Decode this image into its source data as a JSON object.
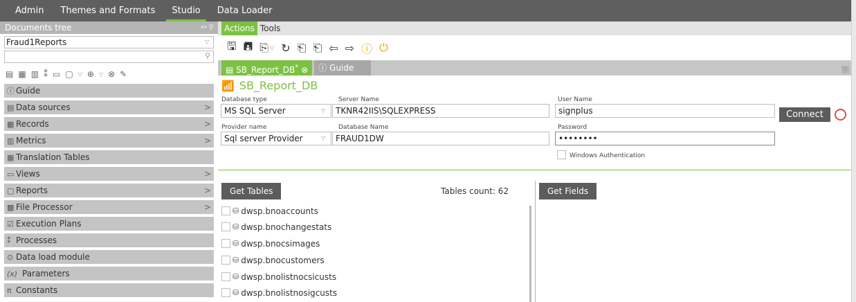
{
  "topmenu": {
    "items": [
      "Admin",
      "Themes and Formats",
      "Studio",
      "Data Loader"
    ],
    "active": "Studio"
  },
  "left": {
    "doc_tree_title": "Documents tree",
    "doc_tree_ctrls": "↔ ⚲",
    "report_select": "Fraud1Reports",
    "search_placeholder": "",
    "nav": [
      {
        "label": "Guide",
        "icon": "ⓘ",
        "chevron": ""
      },
      {
        "label": "Data sources",
        "icon": "▤",
        "chevron": ">"
      },
      {
        "label": "Records",
        "icon": "▦",
        "chevron": ">"
      },
      {
        "label": "Metrics",
        "icon": "▥",
        "chevron": ">"
      },
      {
        "label": "Translation Tables",
        "icon": "▦",
        "chevron": ""
      },
      {
        "label": "Views",
        "icon": "▭",
        "chevron": ">"
      },
      {
        "label": "Reports",
        "icon": "▢",
        "chevron": ">"
      },
      {
        "label": "File Processor",
        "icon": "▩",
        "chevron": ">"
      },
      {
        "label": "Execution Plans",
        "icon": "☑",
        "chevron": ""
      },
      {
        "label": "Processes",
        "icon": "⁑",
        "chevron": ""
      },
      {
        "label": "Data load module",
        "icon": "⊙",
        "chevron": ""
      },
      {
        "label": "Parameters",
        "icon": "(x)",
        "chevron": ""
      },
      {
        "label": "Constants",
        "icon": "π",
        "chevron": ""
      }
    ]
  },
  "actions": {
    "tabs": [
      "Actions",
      "Tools"
    ],
    "active": "Actions"
  },
  "doc_tabs": {
    "active_label": "SB_Report_DB",
    "active_mark": "*",
    "active_close": "⊗",
    "guide_label": "Guide"
  },
  "conn": {
    "title": "SB_Report_DB",
    "db_type_label": "Database type",
    "db_type_value": "MS SQL Server",
    "server_label": "Server Name",
    "server_value": "TKNR42IIS\\SQLEXPRESS",
    "user_label": "User Name",
    "user_value": "signplus",
    "provider_label": "Provider name",
    "provider_value": "Sql server Provider",
    "dbname_label": "Database Name",
    "dbname_value": "FRAUD1DW",
    "password_label": "Password",
    "password_value": "••••••••",
    "winauth_label": "Windows Authentication",
    "connect_label": "Connect"
  },
  "tables": {
    "get_tables_label": "Get Tables",
    "count_text": "Tables count: 62",
    "items": [
      "dwsp.bnoaccounts",
      "dwsp.bnochangestats",
      "dwsp.bnocsimages",
      "dwsp.bnocustomers",
      "dwsp.bnolistnocsicusts",
      "dwsp.bnolistnosigcusts"
    ]
  },
  "fields": {
    "get_fields_label": "Get Fields"
  },
  "colors": {
    "accent": "#7cc242",
    "topbar": "#5f5f5f",
    "nav": "#c4c4c4",
    "button": "#5c5c5c",
    "status": "#e74c3c"
  }
}
